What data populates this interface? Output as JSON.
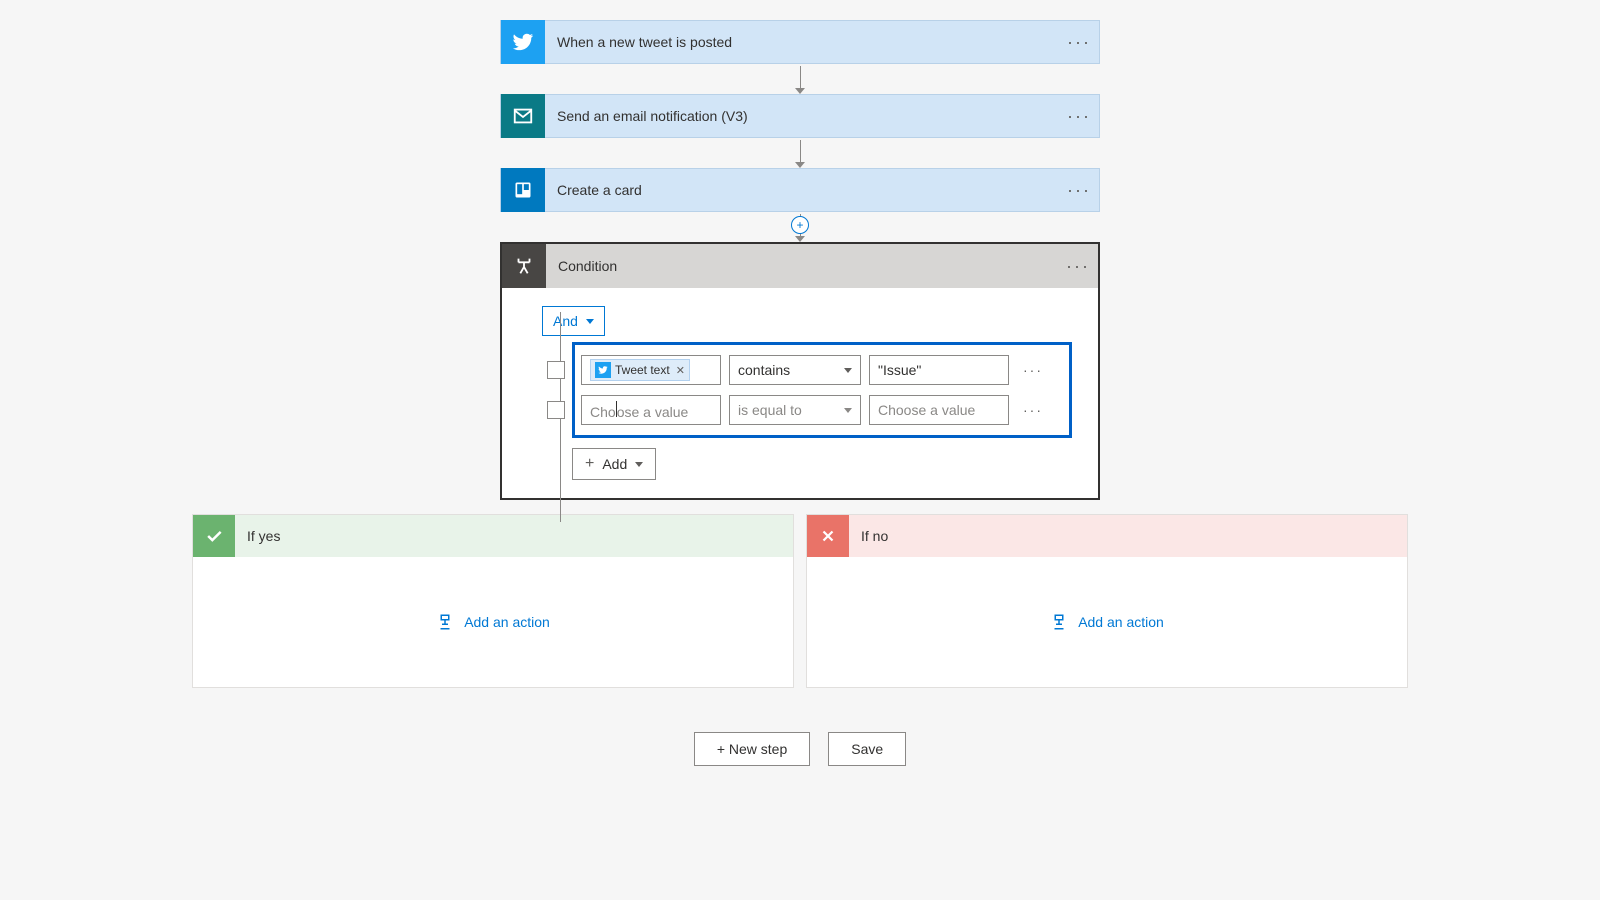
{
  "steps": [
    {
      "title": "When a new tweet is posted"
    },
    {
      "title": "Send an email notification (V3)"
    },
    {
      "title": "Create a card"
    }
  ],
  "condition": {
    "title": "Condition",
    "group_operator": "And",
    "rows": [
      {
        "token_label": "Tweet text",
        "operator": "contains",
        "rhs": "\"Issue\""
      },
      {
        "lhs_placeholder": "Choose a value",
        "operator": "is equal to",
        "rhs_placeholder": "Choose a value"
      }
    ],
    "add_label": "Add"
  },
  "branches": {
    "yes_label": "If yes",
    "no_label": "If no",
    "add_action_label": "Add an action"
  },
  "buttons": {
    "new_step": "+ New step",
    "save": "Save"
  }
}
